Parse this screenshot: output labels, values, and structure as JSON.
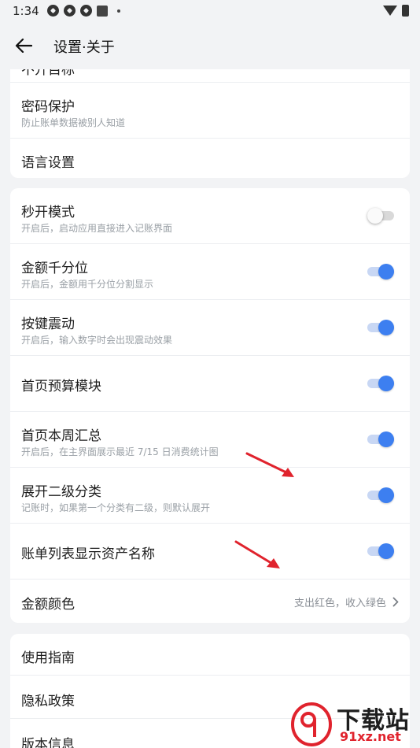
{
  "status_bar": {
    "time": "1:34"
  },
  "header": {
    "title": "设置·关于"
  },
  "card1": {
    "partial_item": "不开目标",
    "items": [
      {
        "title": "密码保护",
        "subtitle": "防止账单数据被别人知道"
      },
      {
        "title": "语言设置"
      }
    ]
  },
  "card2": {
    "items": [
      {
        "title": "秒开模式",
        "subtitle": "开启后，启动应用直接进入记账界面",
        "toggle": false
      },
      {
        "title": "金额千分位",
        "subtitle": "开启后，金额用千分位分割显示",
        "toggle": true
      },
      {
        "title": "按键震动",
        "subtitle": "开启后，输入数字时会出现震动效果",
        "toggle": true
      },
      {
        "title": "首页预算模块",
        "toggle": true
      },
      {
        "title": "首页本周汇总",
        "subtitle": "开启后，在主界面展示最近 7/15 日消费统计图",
        "toggle": true
      },
      {
        "title": "展开二级分类",
        "subtitle": "记账时，如果第一个分类有二级，则默认展开",
        "toggle": true
      },
      {
        "title": "账单列表显示资产名称",
        "toggle": true
      }
    ],
    "amount_color": {
      "title": "金额颜色",
      "value": "支出红色，收入绿色"
    }
  },
  "card3": {
    "items": [
      {
        "title": "使用指南"
      },
      {
        "title": "隐私政策"
      },
      {
        "title": "版本信息"
      }
    ]
  },
  "watermark": {
    "text": "下载站",
    "url": "91xz.net"
  },
  "colors": {
    "accent": "#3d7ff0",
    "annotation_arrow": "#e0232d"
  },
  "icons": [
    "back-arrow-icon",
    "chevron-right-icon",
    "wifi-icon",
    "battery-icon"
  ]
}
